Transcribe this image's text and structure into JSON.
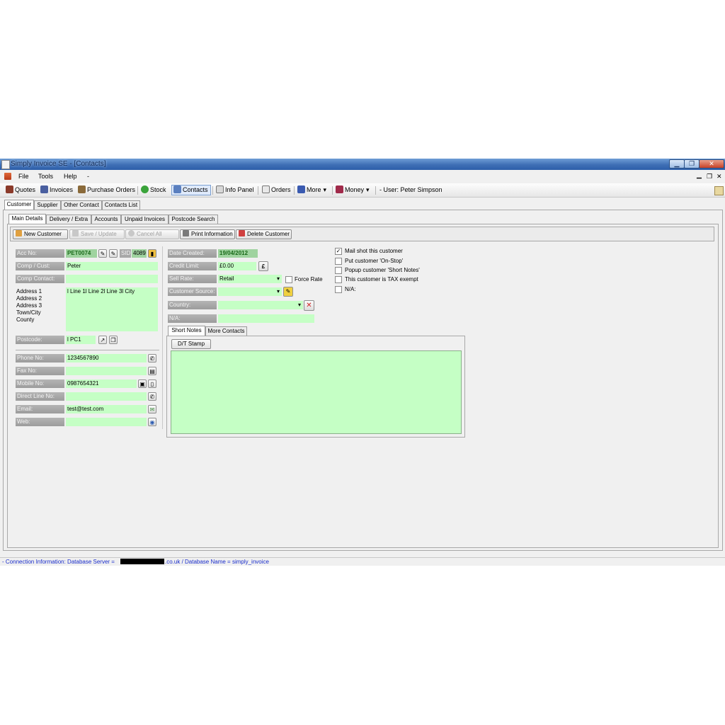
{
  "window": {
    "title": "Simply Invoice SE - [Contacts]"
  },
  "menu": {
    "items": [
      "File",
      "Tools",
      "Help",
      "-"
    ]
  },
  "toolbar": {
    "quotes": "Quotes",
    "invoices": "Invoices",
    "purchase_orders": "Purchase Orders",
    "stock": "Stock",
    "contacts": "Contacts",
    "info_panel": "Info Panel",
    "orders": "Orders",
    "more": "More",
    "money": "Money",
    "user": "- User: Peter Simpson"
  },
  "tabs_top": [
    "Customer",
    "Supplier",
    "Other Contact",
    "Contacts List"
  ],
  "tabs_sub": [
    "Main Details",
    "Delivery / Extra",
    "Accounts",
    "Unpaid Invoices",
    "Postcode Search"
  ],
  "actions": {
    "new_customer": "New Customer",
    "save_update": "Save / Update",
    "cancel_all": "Cancel All",
    "print_information": "Print Information",
    "delete_customer": "Delete Customer"
  },
  "left": {
    "acc_no_label": "Acc No:",
    "acc_no": "PET0074",
    "sid_label": "SID",
    "sid_value": "4089",
    "comp_cust_label": "Comp / Cust:",
    "comp_cust": "Peter",
    "comp_contact_label": "Comp Contact:",
    "comp_contact": "",
    "address_labels": [
      "Address 1",
      "Address 2",
      "Address 3",
      "Town/City",
      "County"
    ],
    "address_value": "l Line 1l Line 2l Line 3l City",
    "postcode_label": "Postcode:",
    "postcode": "l PC1",
    "phone_label": "Phone No:",
    "phone": "1234567890",
    "fax_label": "Fax No:",
    "fax": "",
    "mobile_label": "Mobile No:",
    "mobile": "0987654321",
    "direct_label": "Direct Line No:",
    "direct": "",
    "email_label": "Email:",
    "email": "test@test.com",
    "web_label": "Web:",
    "web": ""
  },
  "middle": {
    "date_created_label": "Date Created:",
    "date_created": "19/04/2012",
    "credit_limit_label": "Credit Limit:",
    "credit_limit": "£0.00",
    "currency_symbol": "£",
    "sell_rate_label": "Sell Rate:",
    "sell_rate": "Retail",
    "force_rate": "Force Rate",
    "customer_source_label": "Customer Source:",
    "customer_source": "",
    "country_label": "Country:",
    "country": "",
    "na_label": "N/A:",
    "na": ""
  },
  "notes_tabs": [
    "Short Notes",
    "More Contacts"
  ],
  "notes": {
    "dt_stamp": "D/T Stamp",
    "text": ""
  },
  "checkboxes": [
    {
      "label": "Mail shot this customer",
      "checked": true
    },
    {
      "label": "Put customer 'On-Stop'",
      "checked": false
    },
    {
      "label": "Popup customer 'Short Notes'",
      "checked": false
    },
    {
      "label": "This customer is TAX exempt",
      "checked": false
    },
    {
      "label": "N/A:",
      "checked": false
    }
  ],
  "status": {
    "connection": "- Connection Information: Database Server = ",
    "redacted": "██████████",
    "connection_tail": ".co.uk / Database Name = simply_invoice"
  },
  "colors": {
    "field_bg": "#c5ffc5",
    "label_bg": "#a8a8a8",
    "titlebar": "#3f6fb5",
    "status_text": "#1a2dcc"
  }
}
